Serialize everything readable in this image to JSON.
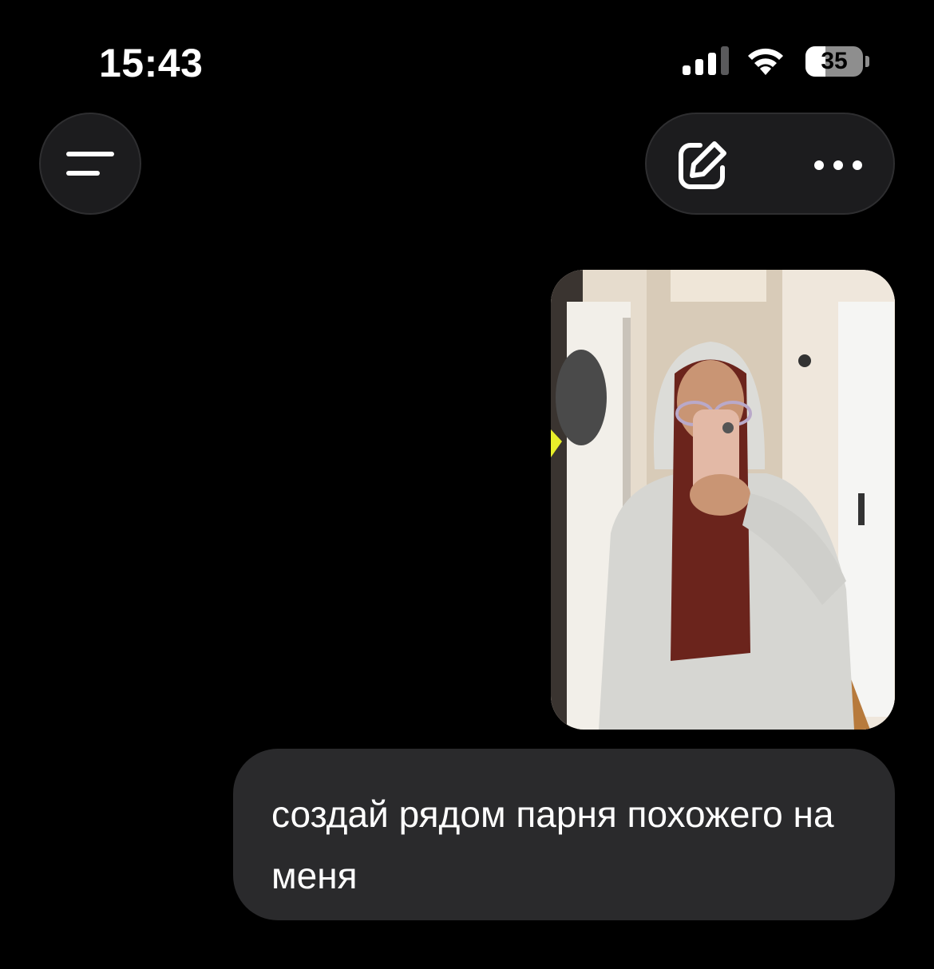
{
  "status_bar": {
    "time": "15:43",
    "battery_percent": "35",
    "battery_level": 0.35,
    "signal_bars_active": 3,
    "signal_bars_total": 4
  },
  "header": {
    "menu_icon": "menu-icon",
    "edit_icon": "compose-icon",
    "more_icon": "more-horizontal-icon"
  },
  "chat": {
    "messages": [
      {
        "type": "image",
        "sender": "user"
      },
      {
        "type": "text",
        "sender": "user",
        "text": "создай рядом парня похожего на меня"
      }
    ]
  },
  "colors": {
    "background": "#000000",
    "bubble": "#2a2a2c",
    "button_bg": "#1c1c1e"
  }
}
